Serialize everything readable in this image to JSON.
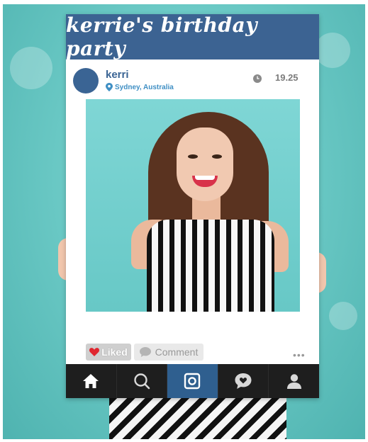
{
  "banner": {
    "title": "kerrie's birthday party"
  },
  "post": {
    "username": "kerri",
    "location": "Sydney, Australia",
    "time": "19.25"
  },
  "actions": {
    "liked_label": "Liked",
    "comment_label": "Comment",
    "more_label": "•••"
  },
  "tabbar": {
    "tabs": [
      {
        "icon": "home-icon",
        "active": false
      },
      {
        "icon": "search-icon",
        "active": false
      },
      {
        "icon": "camera-icon",
        "active": true
      },
      {
        "icon": "activity-heart-icon",
        "active": false
      },
      {
        "icon": "profile-icon",
        "active": false
      }
    ]
  },
  "colors": {
    "banner": "#3c6392",
    "background": "#6ccac6",
    "tabbar": "#1e1e1e",
    "active_tab": "#2f5f8f",
    "heart": "#e0262f"
  }
}
